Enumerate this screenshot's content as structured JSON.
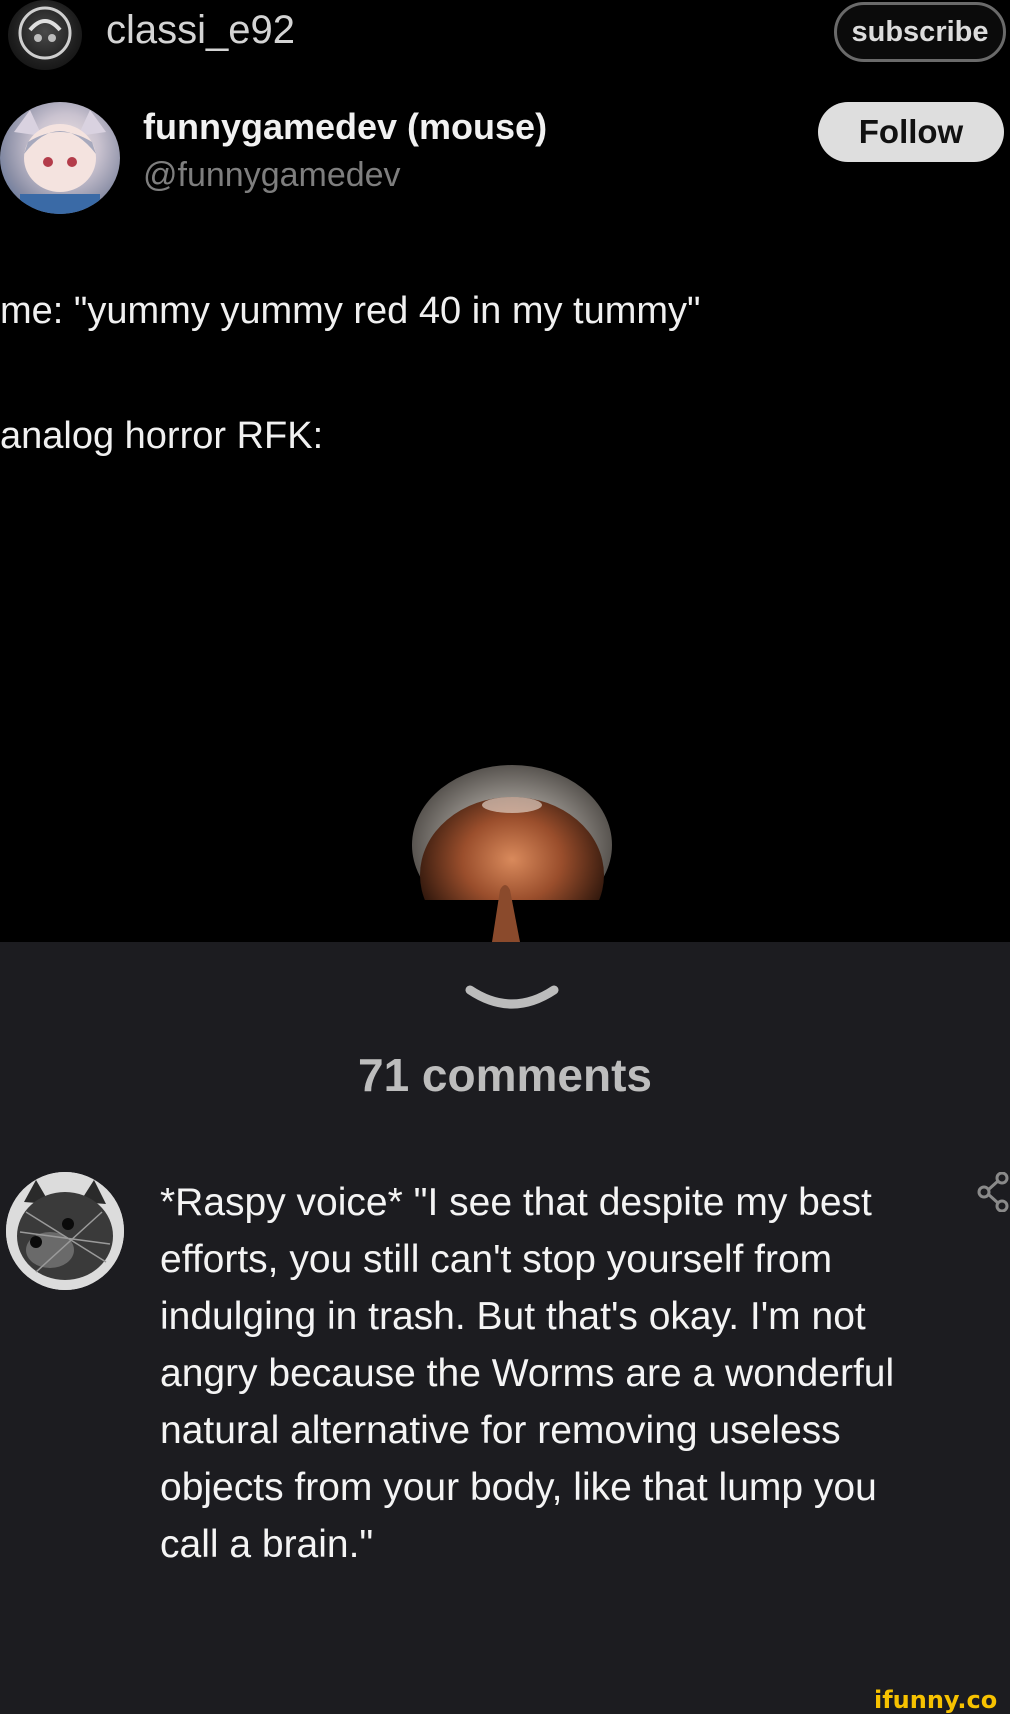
{
  "header": {
    "username": "classi_e92",
    "subscribe_label": "subscribe"
  },
  "tweet": {
    "display_name": "funnygamedev (mouse)",
    "handle": "@funnygamedev",
    "follow_label": "Follow",
    "line1": "me: \"yummy yummy red 40 in my tummy\"",
    "line2": "analog horror RFK:"
  },
  "comments": {
    "count_label": "71 comments",
    "items": [
      {
        "text": "*Raspy voice* \"I see that despite my best efforts, you still can't stop yourself from indulging in trash. But that's okay. I'm not angry because the Worms are a wonderful natural alternative for removing useless objects from your body, like that lump you call a brain.\""
      }
    ]
  },
  "watermark": "ifunny.co",
  "colors": {
    "background": "#000000",
    "comments_background": "#1c1c20",
    "follow_button": "#dedede",
    "watermark": "#f7c200"
  }
}
